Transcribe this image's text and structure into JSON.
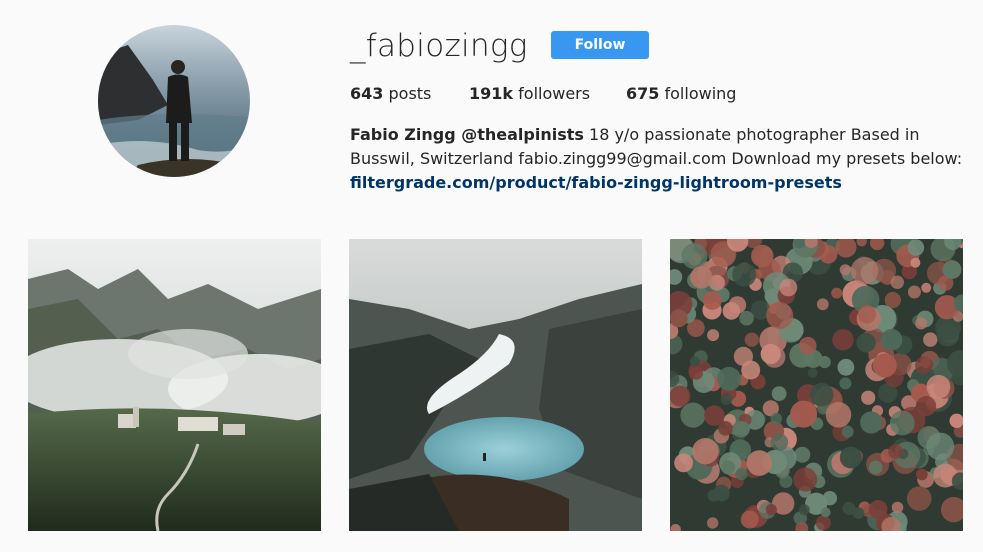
{
  "profile": {
    "username": "_fabiozingg",
    "follow_label": "Follow",
    "stats": {
      "posts_count": "643",
      "posts_label": "posts",
      "followers_count": "191k",
      "followers_label": "followers",
      "following_count": "675",
      "following_label": "following"
    },
    "bio": {
      "name": "Fabio Zingg @thealpinists",
      "text": " 18 y/o passionate photographer Based in Busswil, Switzerland fabio.zingg99@gmail.com Download my presets below:",
      "link": "filtergrade.com/product/fabio-zingg-lightroom-presets"
    }
  },
  "colors": {
    "follow_button": "#3897f0",
    "link": "#003569",
    "background": "#fafafa"
  }
}
